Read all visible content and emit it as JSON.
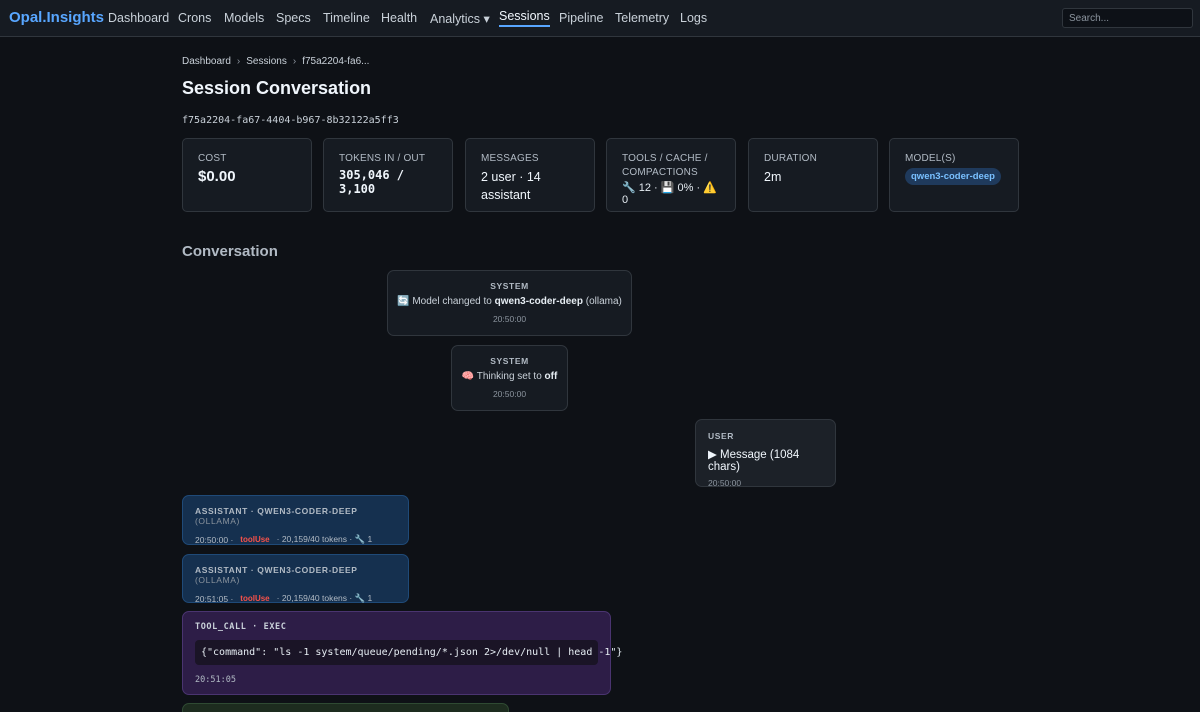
{
  "nav": {
    "brand": "Opal.Insights",
    "items": [
      "Dashboard",
      "Crons",
      "Models",
      "Specs",
      "Timeline",
      "Health",
      "Analytics ▾",
      "Sessions",
      "Pipeline",
      "Telemetry",
      "Logs"
    ],
    "active": "Sessions",
    "search_placeholder": "Search..."
  },
  "breadcrumb": [
    "Dashboard",
    "Sessions",
    "f75a2204-fa6..."
  ],
  "page_title": "Session Conversation",
  "session_id": "f75a2204-fa67-4404-b967-8b32122a5ff3",
  "stats": {
    "cost": {
      "label": "COST",
      "value": "$0.00"
    },
    "tokens": {
      "label": "TOKENS IN / OUT",
      "value": "305,046 / 3,100"
    },
    "messages": {
      "label": "MESSAGES",
      "value": "2 user · 14 assistant"
    },
    "tools": {
      "label": "TOOLS / CACHE / COMPACTIONS",
      "value": "🔧 12 · 💾 0% · ⚠️ 0"
    },
    "duration": {
      "label": "DURATION",
      "value": "2m"
    },
    "models": {
      "label": "MODEL(S)",
      "value": "qwen3-coder-deep"
    }
  },
  "conversation": {
    "heading": "Conversation",
    "sys1": {
      "role": "SYSTEM",
      "prefix": "🔄 Model changed to ",
      "model": "qwen3-coder-deep",
      "suffix": " (ollama)",
      "time": "20:50:00"
    },
    "sys2": {
      "role": "SYSTEM",
      "prefix": "🧠 Thinking set to ",
      "value": "off",
      "time": "20:50:00"
    },
    "user1": {
      "role": "USER",
      "text": "▶ Message (1084 chars)",
      "time": "20:50:00"
    },
    "asst1": {
      "role": "ASSISTANT · QWEN3-CODER-DEEP",
      "provider": "(OLLAMA)",
      "time": "20:50:00 ·",
      "tag": "toolUse",
      "info": "· 20,159/40 tokens · 🔧 1"
    },
    "asst2": {
      "role": "ASSISTANT · QWEN3-CODER-DEEP",
      "provider": "(OLLAMA)",
      "time": "20:51:05 ·",
      "tag": "toolUse",
      "info": "· 20,159/40 tokens · 🔧 1"
    },
    "tool1": {
      "role": "TOOL_CALL · EXEC",
      "code": "{\"command\": \"ls -1 system/queue/pending/*.json 2>/dev/null | head -1\"}",
      "time": "20:51:05"
    }
  }
}
